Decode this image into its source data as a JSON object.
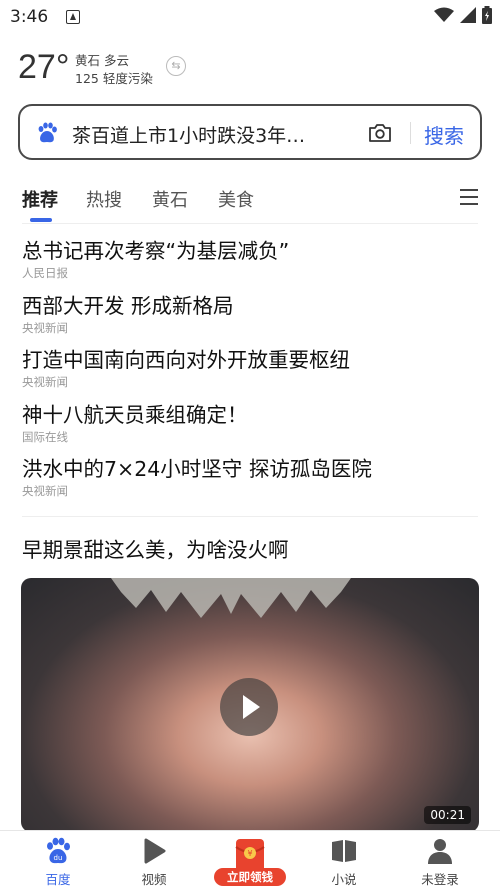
{
  "status_bar": {
    "time": "3:46"
  },
  "weather": {
    "temperature": "27°",
    "city_condition": "黄石 多云",
    "air_quality": "125 轻度污染"
  },
  "search": {
    "query": "茶百道上市1小时跌没3年…",
    "button_label": "搜索"
  },
  "tabs": [
    {
      "label": "推荐",
      "active": true
    },
    {
      "label": "热搜",
      "active": false
    },
    {
      "label": "黄石",
      "active": false
    },
    {
      "label": "美食",
      "active": false
    }
  ],
  "news": [
    {
      "title": "总书记再次考察“为基层减负”",
      "source": "人民日报"
    },
    {
      "title": "西部大开发 形成新格局",
      "source": "央视新闻"
    },
    {
      "title": "打造中国南向西向对外开放重要枢纽",
      "source": "央视新闻"
    },
    {
      "title": "神十八航天员乘组确定！",
      "source": "国际在线"
    },
    {
      "title": "洪水中的7×24小时坚守 探访孤岛医院",
      "source": "央视新闻"
    }
  ],
  "video": {
    "title": "早期景甜这么美，为啥没火啊",
    "duration": "00:21"
  },
  "bottom_nav": [
    {
      "label": "百度",
      "icon": "baidu-paw-icon",
      "active": true
    },
    {
      "label": "视频",
      "icon": "video-play-icon",
      "active": false
    },
    {
      "label": "立即领钱",
      "icon": "red-envelope-icon",
      "active": false
    },
    {
      "label": "小说",
      "icon": "book-icon",
      "active": false
    },
    {
      "label": "未登录",
      "icon": "user-icon",
      "active": false
    }
  ],
  "colors": {
    "accent": "#3966e6",
    "promo": "#e8432e",
    "text": "#111111",
    "muted": "#999999"
  }
}
